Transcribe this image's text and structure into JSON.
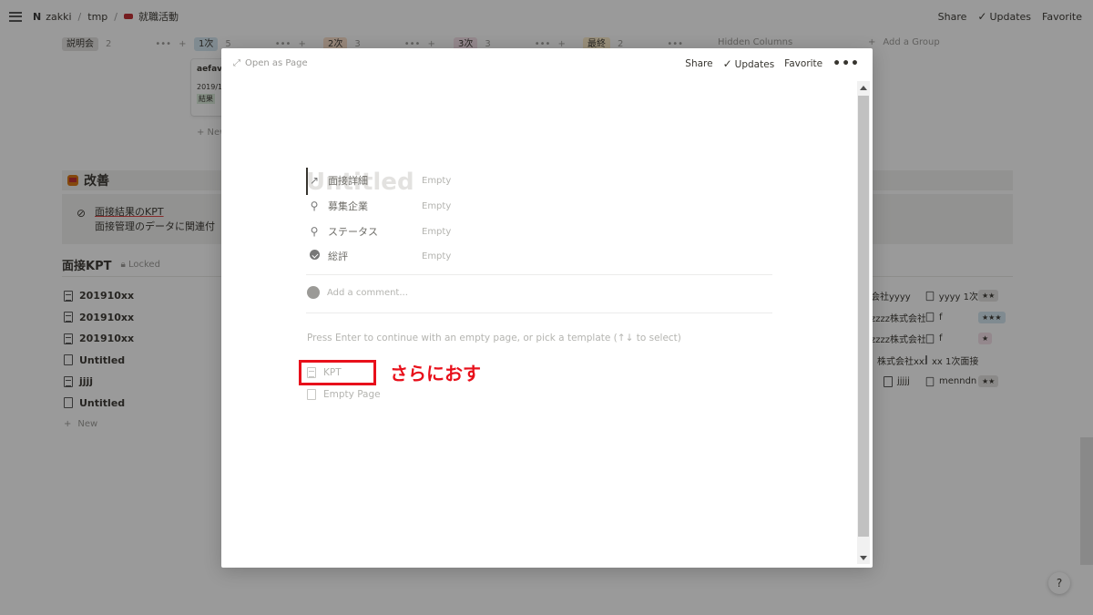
{
  "topbar": {
    "breadcrumb": [
      "zakki",
      "tmp",
      "就職活動"
    ],
    "actions": {
      "share": "Share",
      "updates": "Updates",
      "favorite": "Favorite"
    }
  },
  "board": {
    "groups": [
      {
        "label": "説明会",
        "count": "2",
        "color": "#e3e2e0"
      },
      {
        "label": "1次",
        "count": "5",
        "color": "#d3e5ef"
      },
      {
        "label": "2次",
        "count": "3",
        "color": "#fadec9"
      },
      {
        "label": "3次",
        "count": "3",
        "color": "#f5e0e9"
      },
      {
        "label": "最終",
        "count": "2",
        "color": "#fdecc8"
      }
    ],
    "hidden_columns": "Hidden Columns",
    "add_group": "Add a Group",
    "card": {
      "title": "aefav",
      "date": "2019/1",
      "tag": "結果"
    },
    "card_new": "+ New"
  },
  "callout": {
    "title": "改善"
  },
  "note": {
    "link": "面接結果のKPT",
    "desc": "面接管理のデータに関連付"
  },
  "db": {
    "title": "面接KPT",
    "locked": "Locked",
    "rows": [
      {
        "title": "201910xx",
        "lined": true
      },
      {
        "title": "201910xx",
        "lined": true
      },
      {
        "title": "201910xx",
        "lined": true
      },
      {
        "title": "Untitled",
        "lined": false
      },
      {
        "title": "jjjj",
        "lined": true
      },
      {
        "title": "Untitled",
        "lined": false
      }
    ],
    "new": "New",
    "right_rows": [
      {
        "company": "会社yyyy",
        "rel": "yyyy 1次",
        "stars": "★★",
        "star_color": "#e3e2e0"
      },
      {
        "company": "zzzz株式会社",
        "rel": "f",
        "stars": "★★★",
        "star_color": "#d3e5ef"
      },
      {
        "company": "zzzz株式会社",
        "rel": "f",
        "stars": "★",
        "star_color": "#f5e0e9"
      },
      {
        "company": "株式会社xxxx",
        "rel": "xx 1次面接",
        "stars": "",
        "star_color": ""
      },
      {
        "company": "jjjjj",
        "rel": "menndn",
        "stars": "★★",
        "star_color": "#e3e2e0"
      }
    ]
  },
  "help": "?",
  "modal": {
    "open_as_page": "Open as Page",
    "share": "Share",
    "updates": "Updates",
    "favorite": "Favorite",
    "more": "•••",
    "title_placeholder": "Untitled",
    "properties": [
      {
        "icon": "arrow-icon",
        "glyph": "↗",
        "name": "面接詳細",
        "value": "Empty"
      },
      {
        "icon": "search-icon",
        "glyph": "⚲",
        "name": "募集企業",
        "value": "Empty"
      },
      {
        "icon": "search-icon",
        "glyph": "⚲",
        "name": "ステータス",
        "value": "Empty"
      },
      {
        "icon": "formula-icon",
        "glyph": "",
        "name": "総評",
        "value": "Empty"
      }
    ],
    "comment_placeholder": "Add a comment...",
    "template_hint": "Press Enter to continue with an empty page, or pick a template (↑↓ to select)",
    "templates": [
      "KPT",
      "Empty Page"
    ]
  },
  "annotation": {
    "text": "さらにおす",
    "color": "#e8101b"
  }
}
